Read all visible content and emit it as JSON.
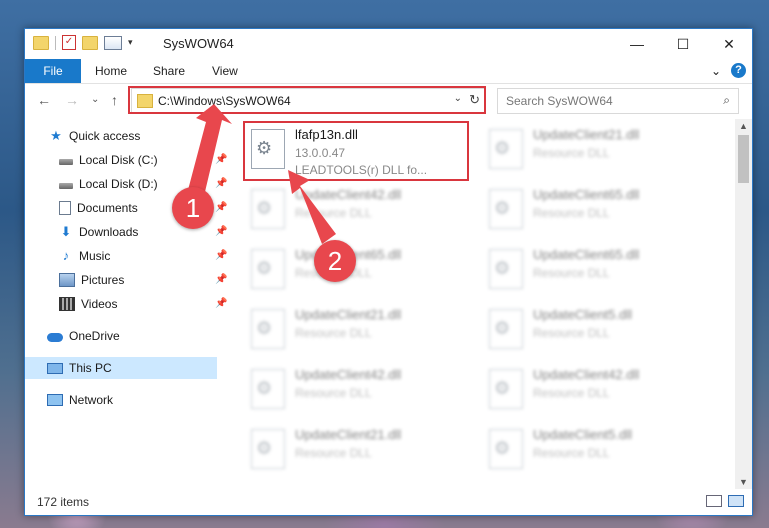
{
  "window": {
    "title": "SysWOW64",
    "controls": [
      "—",
      "☐",
      "✕"
    ]
  },
  "ribbon": {
    "tabs": [
      "File",
      "Home",
      "Share",
      "View"
    ],
    "expand_glyph": "⌄",
    "help_glyph": "?"
  },
  "nav": {
    "back": "←",
    "forward": "→",
    "recent": "⌄",
    "up": "↑",
    "address": "C:\\Windows\\SysWOW64",
    "address_dropdown": "⌄",
    "refresh": "↻",
    "search_placeholder": "Search SysWOW64",
    "search_glyph": "⌕"
  },
  "sidebar": {
    "items": [
      {
        "label": "Quick access",
        "icon": "star-icon",
        "pinned": false
      },
      {
        "label": "Local Disk (C:)",
        "icon": "disk-icon",
        "pinned": true
      },
      {
        "label": "Local Disk (D:)",
        "icon": "disk-icon",
        "pinned": true
      },
      {
        "label": "Documents",
        "icon": "documents-icon",
        "pinned": true
      },
      {
        "label": "Downloads",
        "icon": "downloads-icon",
        "pinned": true
      },
      {
        "label": "Music",
        "icon": "music-icon",
        "pinned": true
      },
      {
        "label": "Pictures",
        "icon": "pictures-icon",
        "pinned": true
      },
      {
        "label": "Videos",
        "icon": "videos-icon",
        "pinned": true
      },
      {
        "label": "OneDrive",
        "icon": "onedrive-icon",
        "pinned": false
      },
      {
        "label": "This PC",
        "icon": "pc-icon",
        "pinned": false,
        "selected": true
      },
      {
        "label": "Network",
        "icon": "network-icon",
        "pinned": false
      }
    ],
    "pin_glyph": "📌"
  },
  "files": [
    {
      "name": "lfafp13n.dll",
      "line2": "13.0.0.47",
      "line3": "LEADTOOLS(r) DLL fo...",
      "blurred": false
    },
    {
      "name": "UpdateClient21.dll",
      "line2": "Resource DLL",
      "blurred": true
    },
    {
      "name": "UpdateClient42.dll",
      "line2": "Resource DLL",
      "blurred": true
    },
    {
      "name": "UpdateClient65.dll",
      "line2": "Resource DLL",
      "blurred": true
    },
    {
      "name": "UpdateClient65.dll",
      "line2": "Resource DLL",
      "blurred": true
    },
    {
      "name": "UpdateClient65.dll",
      "line2": "Resource DLL",
      "blurred": true
    },
    {
      "name": "UpdateClient21.dll",
      "line2": "Resource DLL",
      "blurred": true
    },
    {
      "name": "UpdateClient5.dll",
      "line2": "Resource DLL",
      "blurred": true
    },
    {
      "name": "UpdateClient42.dll",
      "line2": "Resource DLL",
      "blurred": true
    },
    {
      "name": "UpdateClient42.dll",
      "line2": "Resource DLL",
      "blurred": true
    },
    {
      "name": "UpdateClient21.dll",
      "line2": "Resource DLL",
      "blurred": true
    },
    {
      "name": "UpdateClient5.dll",
      "line2": "Resource DLL",
      "blurred": true
    }
  ],
  "status": {
    "item_count": "172 items"
  },
  "annotations": {
    "marker1": "1",
    "marker2": "2",
    "color": "#e8474d"
  }
}
